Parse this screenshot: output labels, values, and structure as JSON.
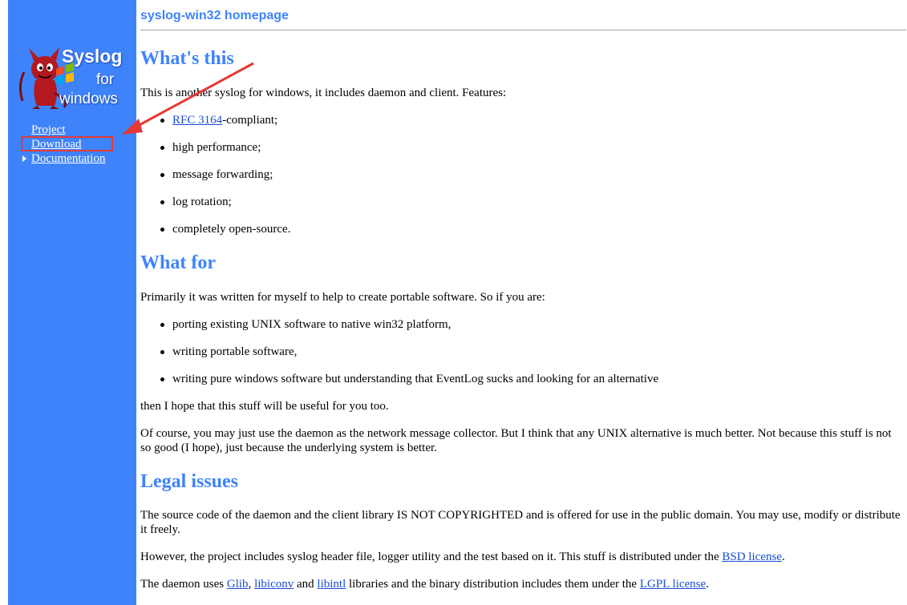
{
  "sidebar": {
    "logo": {
      "word1": "Syslog",
      "word2": "for",
      "word3": "windows",
      "icon": "bsd-daemon-windows-logo"
    },
    "nav": {
      "project": "Project",
      "download": "Download",
      "documentation": "Documentation"
    },
    "bg_color": "#3f83fb"
  },
  "header": {
    "title": "syslog-win32 homepage"
  },
  "sections": {
    "whats_this": {
      "heading": "What's this",
      "intro": "This is another syslog for windows, it includes daemon and client. Features:",
      "feature_rfc_link": "RFC 3164",
      "feature_rfc_rest": "-compliant;",
      "features": [
        "high performance;",
        "message forwarding;",
        "log rotation;",
        "completely open-source."
      ]
    },
    "what_for": {
      "heading": "What for",
      "intro": "Primarily it was written for myself to help to create portable software. So if you are:",
      "items": [
        "porting existing UNIX software to native win32 platform,",
        "writing portable software,",
        "writing pure windows software but understanding that EventLog sucks and looking for an alternative"
      ],
      "after1": "then I hope that this stuff will be useful for you too.",
      "after2": "Of course, you may just use the daemon as the network message collector. But I think that any UNIX alternative is much better. Not because this stuff is not so good (I hope), just because the underlying system is better."
    },
    "legal": {
      "heading": "Legal issues",
      "p1": "The source code of the daemon and the client library IS NOT COPYRIGHTED and is offered for use in the public domain. You may use, modify or distribute it freely.",
      "p2_text": "However, the project includes syslog header file, logger utility and the test based on it. This stuff is distributed under the ",
      "p2_link": "BSD license",
      "p2_end": ".",
      "p3_a": "The daemon uses ",
      "p3_glib": "Glib",
      "p3_b": ", ",
      "p3_libiconv": "libiconv",
      "p3_c": " and ",
      "p3_libintl": "libintl",
      "p3_d": " libraries and the binary distribution includes them under the ",
      "p3_lgpl": "LGPL license",
      "p3_e": "."
    }
  },
  "annotation": {
    "arrow_color": "#e53935",
    "highlight_target": "Download"
  },
  "colors": {
    "heading": "#3f83fb",
    "link": "#1a4dd6"
  }
}
